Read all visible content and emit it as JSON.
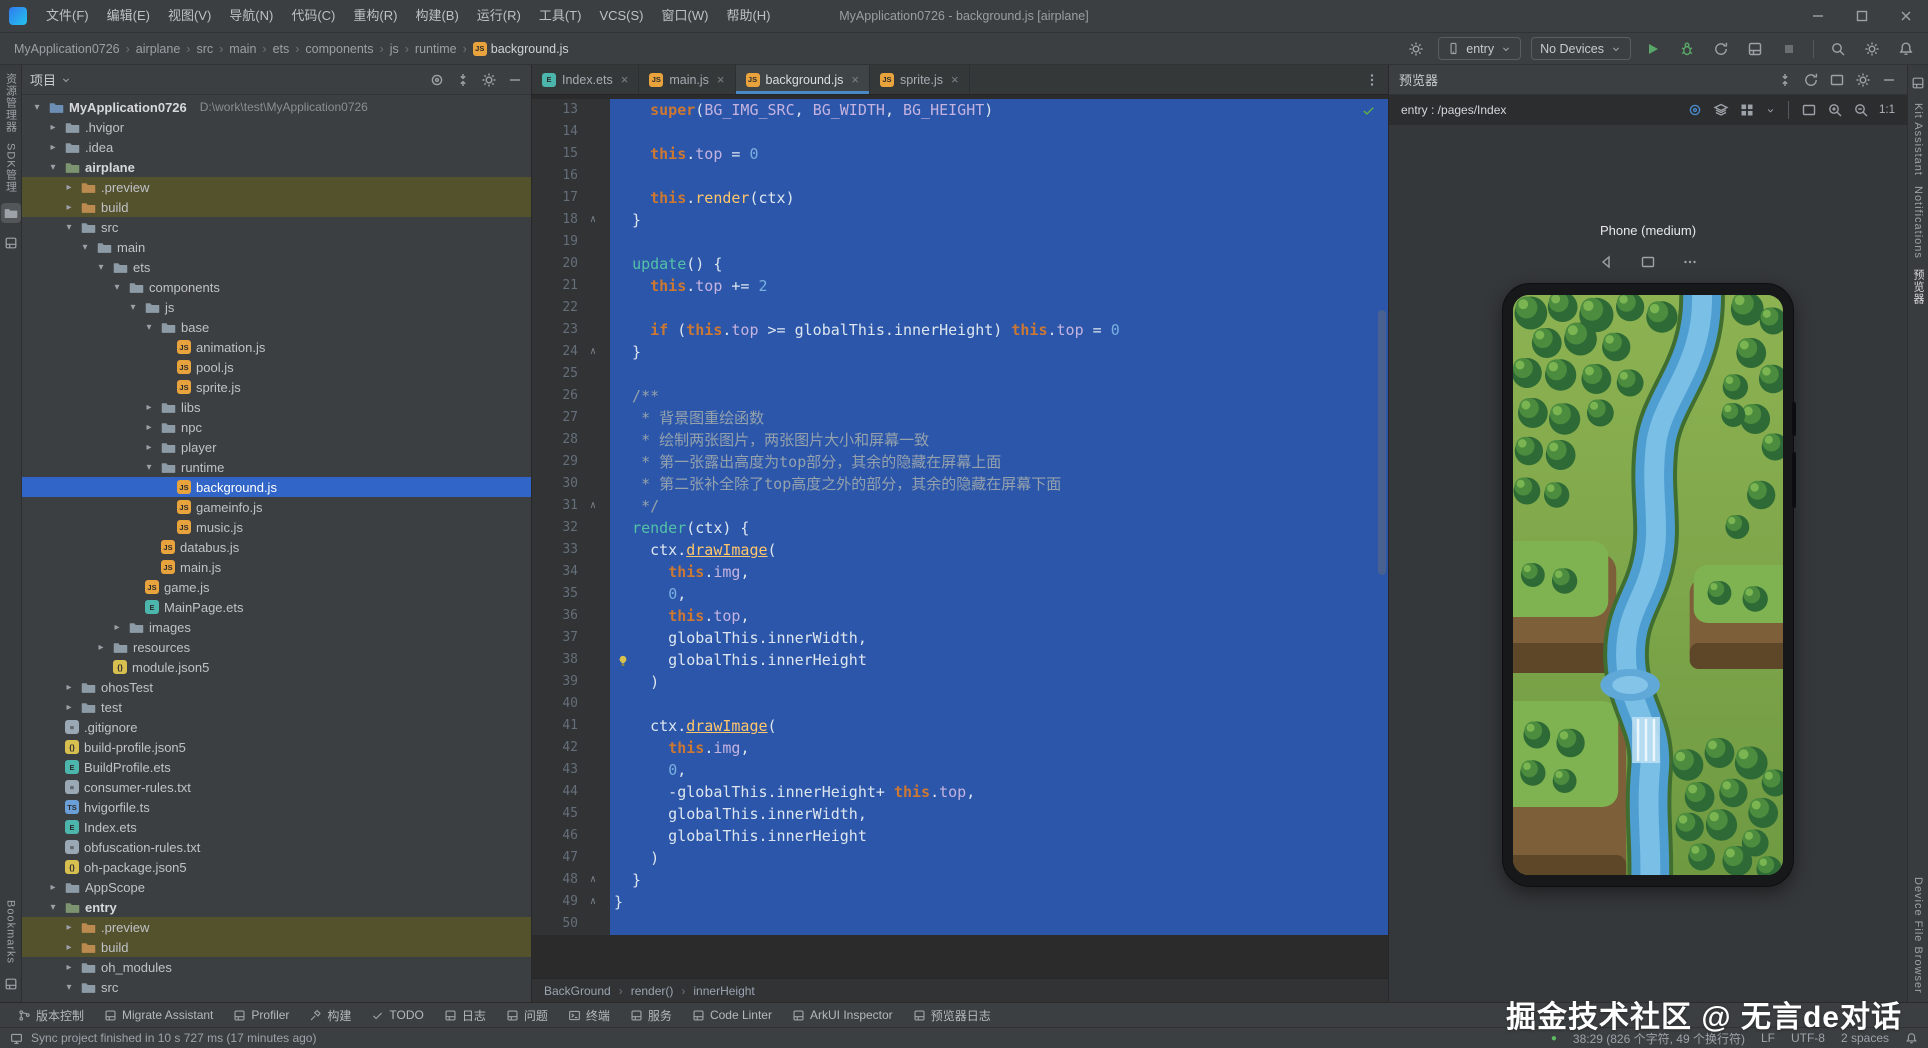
{
  "window": {
    "title": "MyApplication0726 - background.js [airplane]"
  },
  "menu": {
    "items": [
      "文件(F)",
      "编辑(E)",
      "视图(V)",
      "导航(N)",
      "代码(C)",
      "重构(R)",
      "构建(B)",
      "运行(R)",
      "工具(T)",
      "VCS(S)",
      "窗口(W)",
      "帮助(H)"
    ]
  },
  "breadcrumbs": [
    "MyApplication0726",
    "airplane",
    "src",
    "main",
    "ets",
    "components",
    "js",
    "runtime",
    "background.js"
  ],
  "run_toolbar": {
    "module_selector": "entry",
    "device_selector": "No Devices"
  },
  "project_panel": {
    "title": "项目",
    "tree": [
      {
        "d": 0,
        "chev": "open",
        "icon": "project",
        "label": "MyApplication0726",
        "bold": true,
        "path": "D:\\work\\test\\MyApplication0726"
      },
      {
        "d": 1,
        "chev": "closed",
        "icon": "folder",
        "label": ".hvigor"
      },
      {
        "d": 1,
        "chev": "closed",
        "icon": "folder",
        "label": ".idea"
      },
      {
        "d": 1,
        "chev": "open",
        "icon": "module",
        "label": "airplane",
        "bold": true
      },
      {
        "d": 2,
        "chev": "closed",
        "icon": "folder-x",
        "label": ".preview",
        "ex": true
      },
      {
        "d": 2,
        "chev": "closed",
        "icon": "folder-x",
        "label": "build",
        "ex": true
      },
      {
        "d": 2,
        "chev": "open",
        "icon": "folder",
        "label": "src"
      },
      {
        "d": 3,
        "chev": "open",
        "icon": "folder",
        "label": "main"
      },
      {
        "d": 4,
        "chev": "open",
        "icon": "folder",
        "label": "ets"
      },
      {
        "d": 5,
        "chev": "open",
        "icon": "folder",
        "label": "components"
      },
      {
        "d": 6,
        "chev": "open",
        "icon": "folder",
        "label": "js"
      },
      {
        "d": 7,
        "chev": "open",
        "icon": "folder",
        "label": "base"
      },
      {
        "d": 8,
        "icon": "js",
        "label": "animation.js"
      },
      {
        "d": 8,
        "icon": "js",
        "label": "pool.js"
      },
      {
        "d": 8,
        "icon": "js",
        "label": "sprite.js"
      },
      {
        "d": 7,
        "chev": "closed",
        "icon": "folder",
        "label": "libs"
      },
      {
        "d": 7,
        "chev": "closed",
        "icon": "folder",
        "label": "npc"
      },
      {
        "d": 7,
        "chev": "closed",
        "icon": "folder",
        "label": "player"
      },
      {
        "d": 7,
        "chev": "open",
        "icon": "folder",
        "label": "runtime"
      },
      {
        "d": 8,
        "icon": "js",
        "label": "background.js",
        "sel": true
      },
      {
        "d": 8,
        "icon": "js",
        "label": "gameinfo.js"
      },
      {
        "d": 8,
        "icon": "js",
        "label": "music.js"
      },
      {
        "d": 7,
        "icon": "js",
        "label": "databus.js"
      },
      {
        "d": 7,
        "icon": "js",
        "label": "main.js"
      },
      {
        "d": 6,
        "icon": "js",
        "label": "game.js"
      },
      {
        "d": 6,
        "icon": "ets",
        "label": "MainPage.ets"
      },
      {
        "d": 5,
        "chev": "closed",
        "icon": "folder",
        "label": "images"
      },
      {
        "d": 4,
        "chev": "closed",
        "icon": "folder",
        "label": "resources"
      },
      {
        "d": 4,
        "icon": "json",
        "label": "module.json5"
      },
      {
        "d": 2,
        "chev": "closed",
        "icon": "folder",
        "label": "ohosTest"
      },
      {
        "d": 2,
        "chev": "closed",
        "icon": "folder",
        "label": "test"
      },
      {
        "d": 1,
        "icon": "txt",
        "label": ".gitignore"
      },
      {
        "d": 1,
        "icon": "json",
        "label": "build-profile.json5"
      },
      {
        "d": 1,
        "icon": "ets",
        "label": "BuildProfile.ets"
      },
      {
        "d": 1,
        "icon": "txt",
        "label": "consumer-rules.txt"
      },
      {
        "d": 1,
        "icon": "ts",
        "label": "hvigorfile.ts"
      },
      {
        "d": 1,
        "icon": "ets",
        "label": "Index.ets"
      },
      {
        "d": 1,
        "icon": "txt",
        "label": "obfuscation-rules.txt"
      },
      {
        "d": 1,
        "icon": "json",
        "label": "oh-package.json5"
      },
      {
        "d": 1,
        "chev": "closed",
        "icon": "folder",
        "label": "AppScope"
      },
      {
        "d": 1,
        "chev": "open",
        "icon": "module",
        "label": "entry",
        "bold": true
      },
      {
        "d": 2,
        "chev": "closed",
        "icon": "folder-x",
        "label": ".preview",
        "ex": true
      },
      {
        "d": 2,
        "chev": "closed",
        "icon": "folder-x",
        "label": "build",
        "ex": true
      },
      {
        "d": 2,
        "chev": "closed",
        "icon": "folder",
        "label": "oh_modules"
      },
      {
        "d": 2,
        "chev": "open",
        "icon": "folder",
        "label": "src"
      }
    ]
  },
  "editor": {
    "tabs": [
      {
        "label": "Index.ets",
        "icon": "ets"
      },
      {
        "label": "main.js",
        "icon": "js"
      },
      {
        "label": "background.js",
        "icon": "js",
        "active": true
      },
      {
        "label": "sprite.js",
        "icon": "js"
      }
    ],
    "first_line": 13,
    "bulb_line": 38,
    "fold_marks": [
      18,
      24,
      31,
      48,
      49
    ],
    "breadcrumb": [
      "BackGround",
      "render()",
      "innerHeight"
    ],
    "lines": [
      {
        "n": 13,
        "t": [
          [
            "d",
            "    "
          ],
          [
            "k",
            "super"
          ],
          [
            "d",
            "("
          ],
          [
            "p",
            "BG_IMG_SRC"
          ],
          [
            "d",
            ", "
          ],
          [
            "p",
            "BG_WIDTH"
          ],
          [
            "d",
            ", "
          ],
          [
            "p",
            "BG_HEIGHT"
          ],
          [
            "d",
            ")"
          ]
        ]
      },
      {
        "n": 14,
        "t": []
      },
      {
        "n": 15,
        "t": [
          [
            "d",
            "    "
          ],
          [
            "k",
            "this"
          ],
          [
            "d",
            "."
          ],
          [
            "p",
            "top"
          ],
          [
            "d",
            " = "
          ],
          [
            "n",
            "0"
          ]
        ]
      },
      {
        "n": 16,
        "t": []
      },
      {
        "n": 17,
        "t": [
          [
            "d",
            "    "
          ],
          [
            "k",
            "this"
          ],
          [
            "d",
            "."
          ],
          [
            "f",
            "render"
          ],
          [
            "d",
            "(ctx)"
          ]
        ]
      },
      {
        "n": 18,
        "t": [
          [
            "d",
            "  }"
          ]
        ]
      },
      {
        "n": 19,
        "t": []
      },
      {
        "n": 20,
        "t": [
          [
            "d",
            "  "
          ],
          [
            "t",
            "update"
          ],
          [
            "d",
            "() {"
          ]
        ]
      },
      {
        "n": 21,
        "t": [
          [
            "d",
            "    "
          ],
          [
            "k",
            "this"
          ],
          [
            "d",
            "."
          ],
          [
            "p",
            "top"
          ],
          [
            "d",
            " += "
          ],
          [
            "n",
            "2"
          ]
        ]
      },
      {
        "n": 22,
        "t": []
      },
      {
        "n": 23,
        "t": [
          [
            "d",
            "    "
          ],
          [
            "k",
            "if"
          ],
          [
            "d",
            " ("
          ],
          [
            "k",
            "this"
          ],
          [
            "d",
            "."
          ],
          [
            "p",
            "top"
          ],
          [
            "d",
            " >= globalThis.innerHeight) "
          ],
          [
            "k",
            "this"
          ],
          [
            "d",
            "."
          ],
          [
            "p",
            "top"
          ],
          [
            "d",
            " = "
          ],
          [
            "n",
            "0"
          ]
        ]
      },
      {
        "n": 24,
        "t": [
          [
            "d",
            "  }"
          ]
        ]
      },
      {
        "n": 25,
        "t": []
      },
      {
        "n": 26,
        "t": [
          [
            "c",
            "  /**"
          ]
        ]
      },
      {
        "n": 27,
        "t": [
          [
            "c",
            "   * 背景图重绘函数"
          ]
        ]
      },
      {
        "n": 28,
        "t": [
          [
            "c",
            "   * 绘制两张图片，两张图片大小和屏幕一致"
          ]
        ]
      },
      {
        "n": 29,
        "t": [
          [
            "c",
            "   * 第一张露出高度为top部分，其余的隐藏在屏幕上面"
          ]
        ]
      },
      {
        "n": 30,
        "t": [
          [
            "c",
            "   * 第二张补全除了top高度之外的部分，其余的隐藏在屏幕下面"
          ]
        ]
      },
      {
        "n": 31,
        "t": [
          [
            "c",
            "   */"
          ]
        ]
      },
      {
        "n": 32,
        "t": [
          [
            "d",
            "  "
          ],
          [
            "t",
            "render"
          ],
          [
            "d",
            "(ctx) {"
          ]
        ]
      },
      {
        "n": 33,
        "t": [
          [
            "d",
            "    ctx."
          ],
          [
            "u",
            "drawImage"
          ],
          [
            "d",
            "("
          ]
        ]
      },
      {
        "n": 34,
        "t": [
          [
            "d",
            "      "
          ],
          [
            "k",
            "this"
          ],
          [
            "d",
            "."
          ],
          [
            "p",
            "img"
          ],
          [
            "d",
            ","
          ]
        ]
      },
      {
        "n": 35,
        "t": [
          [
            "d",
            "      "
          ],
          [
            "n",
            "0"
          ],
          [
            "d",
            ","
          ]
        ]
      },
      {
        "n": 36,
        "t": [
          [
            "d",
            "      "
          ],
          [
            "k",
            "this"
          ],
          [
            "d",
            "."
          ],
          [
            "p",
            "top"
          ],
          [
            "d",
            ","
          ]
        ]
      },
      {
        "n": 37,
        "t": [
          [
            "d",
            "      globalThis.innerWidth,"
          ]
        ]
      },
      {
        "n": 38,
        "t": [
          [
            "d",
            "      globalThis.innerHeight"
          ]
        ]
      },
      {
        "n": 39,
        "t": [
          [
            "d",
            "    )"
          ]
        ]
      },
      {
        "n": 40,
        "t": []
      },
      {
        "n": 41,
        "t": [
          [
            "d",
            "    ctx."
          ],
          [
            "u",
            "drawImage"
          ],
          [
            "d",
            "("
          ]
        ]
      },
      {
        "n": 42,
        "t": [
          [
            "d",
            "      "
          ],
          [
            "k",
            "this"
          ],
          [
            "d",
            "."
          ],
          [
            "p",
            "img"
          ],
          [
            "d",
            ","
          ]
        ]
      },
      {
        "n": 43,
        "t": [
          [
            "d",
            "      "
          ],
          [
            "n",
            "0"
          ],
          [
            "d",
            ","
          ]
        ]
      },
      {
        "n": 44,
        "t": [
          [
            "d",
            "      -globalThis.innerHeight+ "
          ],
          [
            "k",
            "this"
          ],
          [
            "d",
            "."
          ],
          [
            "p",
            "top"
          ],
          [
            "d",
            ","
          ]
        ]
      },
      {
        "n": 45,
        "t": [
          [
            "d",
            "      globalThis.innerWidth,"
          ]
        ]
      },
      {
        "n": 46,
        "t": [
          [
            "d",
            "      globalThis.innerHeight"
          ]
        ]
      },
      {
        "n": 47,
        "t": [
          [
            "d",
            "    )"
          ]
        ]
      },
      {
        "n": 48,
        "t": [
          [
            "d",
            "  }"
          ]
        ]
      },
      {
        "n": 49,
        "t": [
          [
            "d",
            "}"
          ]
        ]
      },
      {
        "n": 50,
        "t": []
      }
    ]
  },
  "preview": {
    "title": "预览器",
    "target": "entry : /pages/Index",
    "device": "Phone (medium)",
    "zoom": "1:1"
  },
  "left_strip": {
    "top_labels": [
      "资源管理器",
      "SDK管理"
    ],
    "bottom_label": "Bookmarks"
  },
  "right_strip": {
    "labels": [
      "Kit Assistant",
      "Notifications",
      "预览器"
    ],
    "bottom_label": "Device File Browser"
  },
  "bottom_bar": {
    "items": [
      "版本控制",
      "Migrate Assistant",
      "Profiler",
      "构建",
      "TODO",
      "日志",
      "问题",
      "终端",
      "服务",
      "Code Linter",
      "ArkUI Inspector",
      "预览器日志"
    ]
  },
  "status_bar": {
    "message": "Sync project finished in 10 s 727 ms (17 minutes ago)",
    "caret": "38:29 (826 个字符, 49 个换行符)",
    "line_ending": "LF",
    "encoding": "UTF-8",
    "indent": "2 spaces"
  },
  "watermark": "掘金技术社区 @ 无言de对话",
  "colors": {
    "accent": "#4a88c7",
    "selection": "#2c56aa",
    "run_green": "#59a869",
    "excluded_row": "#54512d",
    "selected_row": "#3166c8"
  }
}
